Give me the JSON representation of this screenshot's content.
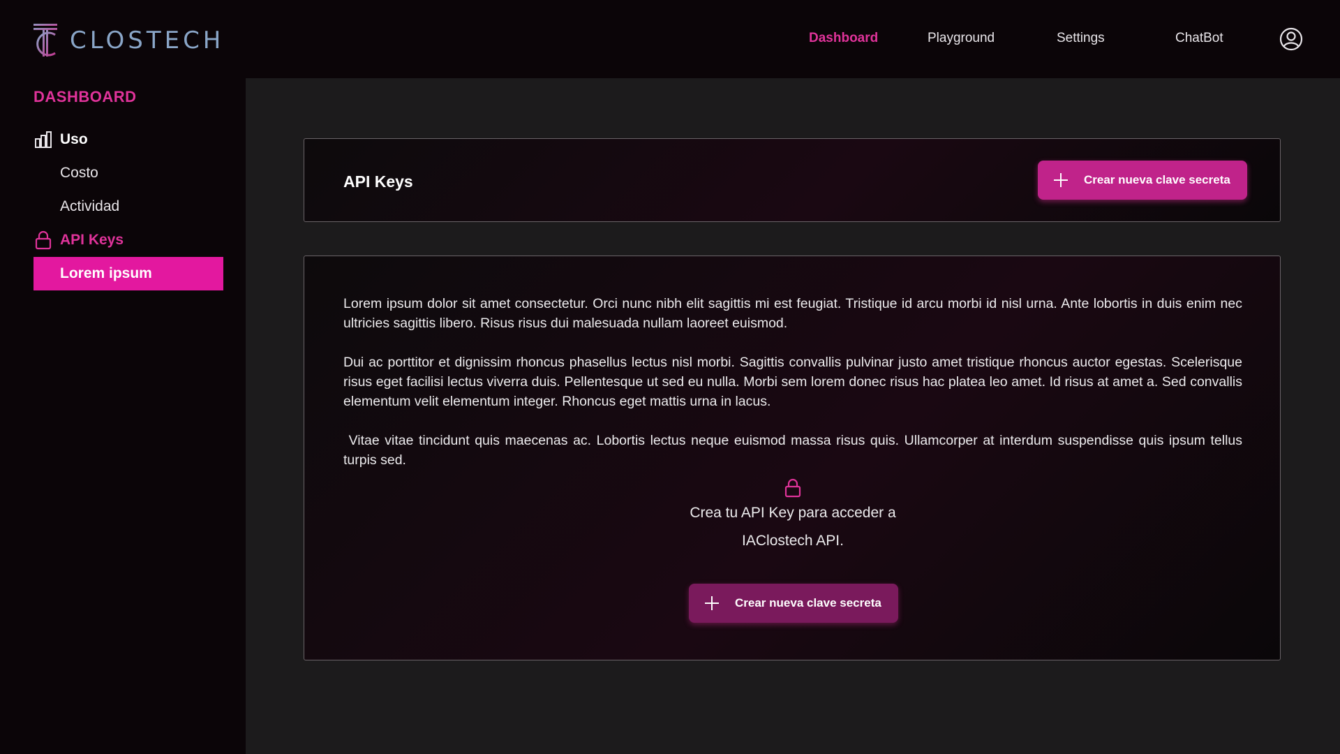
{
  "brand": {
    "name": "CLOSTECH"
  },
  "nav": {
    "items": [
      {
        "label": "Dashboard",
        "active": true
      },
      {
        "label": "Playground",
        "active": false
      },
      {
        "label": "Settings",
        "active": false
      },
      {
        "label": "ChatBot",
        "active": false
      }
    ],
    "profile_icon": "user-circle-icon"
  },
  "sidebar": {
    "title": "DASHBOARD",
    "uso": {
      "label": "Uso",
      "icon": "bar-chart-icon"
    },
    "costo": {
      "label": "Costo"
    },
    "actividad": {
      "label": "Actividad"
    },
    "api_keys": {
      "label": "API Keys",
      "icon": "lock-icon"
    },
    "active_item": {
      "label": "Lorem ipsum"
    }
  },
  "header_card": {
    "title": "API Keys",
    "button_label": "Crear nueva clave secreta",
    "button_icon": "plus-icon"
  },
  "content_card": {
    "paragraphs": [
      "Lorem ipsum dolor sit amet consectetur. Orci nunc nibh elit sagittis mi est feugiat. Tristique id arcu morbi id nisl urna. Ante lobortis in duis enim nec ultricies sagittis libero. Risus risus dui malesuada nullam laoreet euismod.",
      "Dui ac porttitor et dignissim rhoncus phasellus lectus nisl morbi. Sagittis convallis pulvinar justo amet tristique rhoncus auctor egestas. Scelerisque risus eget facilisi lectus viverra duis. Pellentesque ut sed eu nulla. Morbi sem lorem donec risus hac platea leo amet. Id risus at amet a. Sed convallis elementum velit elementum integer. Rhoncus eget mattis urna in lacus.",
      " Vitae vitae tincidunt quis maecenas ac. Lobortis lectus neque euismod massa risus quis. Ullamcorper at interdum suspendisse quis ipsum tellus turpis sed."
    ],
    "cta_line1": "Crea tu API Key para acceder a",
    "cta_line2": "IAClostech API.",
    "button_label": "Crear nueva clave secreta",
    "lock_icon": "lock-icon"
  },
  "colors": {
    "accent": "#e0339a",
    "accent_bright": "#e3189f",
    "background": "#0b0508",
    "main_bg": "#1c1b1c"
  }
}
